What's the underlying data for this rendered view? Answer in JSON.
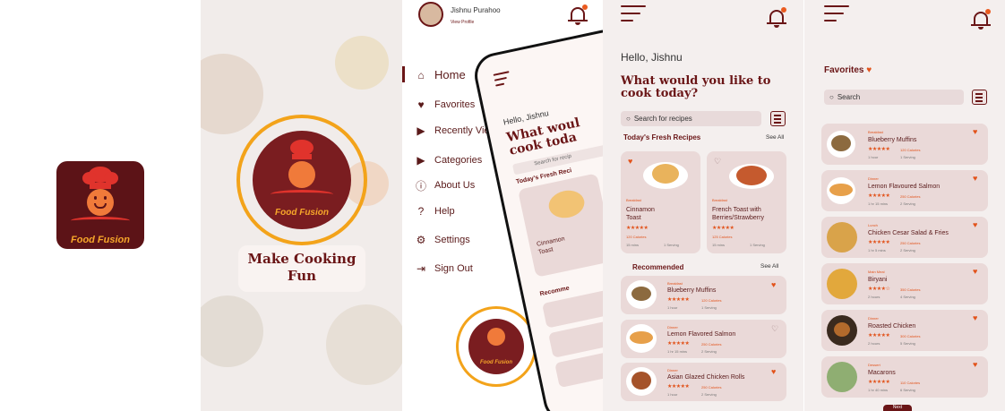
{
  "app": {
    "name": "Food Fusion",
    "tagline_line1": "Make Cooking",
    "tagline_line2": "Fun"
  },
  "colors": {
    "brand": "#6a1516",
    "accent": "#e2531b",
    "gold": "#f3a31a",
    "card": "#ead9d8",
    "background": "#f4efee"
  },
  "menu": {
    "user_name": "Jishnu Purahoo",
    "view_profile": "View Profile",
    "items": [
      {
        "label": "Home",
        "icon": "home-icon"
      },
      {
        "label": "Favorites",
        "icon": "heart-icon"
      },
      {
        "label": "Recently Viewed",
        "icon": "play-icon"
      },
      {
        "label": "Categories",
        "icon": "play-icon"
      },
      {
        "label": "About Us",
        "icon": "info-icon"
      },
      {
        "label": "Help",
        "icon": "help-icon"
      },
      {
        "label": "Settings",
        "icon": "gear-icon"
      },
      {
        "label": "Sign Out",
        "icon": "sign-out-icon"
      }
    ],
    "logo_text": "Food Fusion"
  },
  "phone_preview": {
    "greeting": "Hello, Jishnu",
    "question_line1": "What woul",
    "question_line2": "cook toda",
    "search_placeholder": "Search for recip",
    "section": "Today's Fresh Reci",
    "card_title_line1": "Cinnamon",
    "card_title_line2": "Toast",
    "recommended": "Recomme"
  },
  "home": {
    "greeting": "Hello, Jishnu",
    "question_line1": "What would you like to",
    "question_line2": "cook today?",
    "search_placeholder": "Search for recipes",
    "fresh_title": "Today's Fresh Recipes",
    "see_all": "See All",
    "fresh": [
      {
        "category": "Breakfast",
        "title_line1": "Cinnamon",
        "title_line2": "Toast",
        "calories": "120 Calories",
        "time": "15 mins",
        "serving": "1 Serving",
        "liked": true,
        "stars": "★★★★★"
      },
      {
        "category": "Breakfast",
        "title_line1": "French Toast with",
        "title_line2": "Berries/Strawberry",
        "calories": "125 Calories",
        "time": "15 mins",
        "serving": "1 Serving",
        "liked": false,
        "stars": "★★★★★"
      }
    ],
    "recommended_title": "Recommended",
    "recommended_see_all": "See All",
    "recommended": [
      {
        "category": "Breakfast",
        "title": "Blueberry Muffins",
        "calories": "120 Calories",
        "time": "1 hour",
        "serving": "1 Serving",
        "liked": true
      },
      {
        "category": "Dinner",
        "title": "Lemon Flavored Salmon",
        "calories": "250 Calories",
        "time": "1 hr 15 mins",
        "serving": "2 Serving",
        "liked": false
      },
      {
        "category": "Dinner",
        "title": "Asian Glazed Chicken Rolls",
        "calories": "250 Calories",
        "time": "1 hour",
        "serving": "2 Serving",
        "liked": true
      }
    ]
  },
  "favorites": {
    "title": "Favorites",
    "search_placeholder": "Search",
    "items": [
      {
        "category": "Breakfast",
        "title": "Blueberry Muffins",
        "calories": "120 Calories",
        "time": "1 hour",
        "serving": "1 Serving"
      },
      {
        "category": "Dinner",
        "title": "Lemon Flavoured Salmon",
        "calories": "250 Calories",
        "time": "1 hr 15 mins",
        "serving": "2 Serving"
      },
      {
        "category": "Lunch",
        "title": "Chicken Cesar Salad & Fries",
        "calories": "250 Calories",
        "time": "1 hr 5 mins",
        "serving": "2 Serving"
      },
      {
        "category": "Main Meal",
        "title": "Biryani",
        "calories": "350 Calories",
        "time": "2 hours",
        "serving": "4 Serving"
      },
      {
        "category": "Dinner",
        "title": "Roasted Chicken",
        "calories": "300 Calories",
        "time": "2 hours",
        "serving": "5 Serving"
      },
      {
        "category": "Dessert",
        "title": "Macarons",
        "calories": "110 Calories",
        "time": "1 hr 40 mins",
        "serving": "6 Serving"
      }
    ],
    "next_label": "Next"
  }
}
